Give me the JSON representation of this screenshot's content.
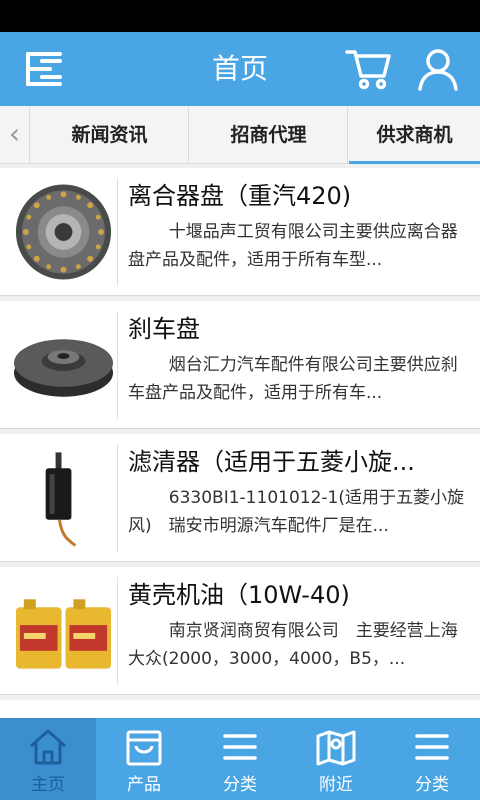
{
  "header": {
    "title": "首页",
    "menu_icon": "menu-icon",
    "cart_icon": "cart-icon",
    "user_icon": "user-icon"
  },
  "tabs": {
    "prev_arrow": "‹",
    "items": [
      {
        "label": "新闻资讯"
      },
      {
        "label": "招商代理"
      },
      {
        "label": "供求商机",
        "active": true
      }
    ]
  },
  "list": [
    {
      "title": "离合器盘（重汽420)",
      "desc": "十堰品声工贸有限公司主要供应离合器盘产品及配件，适用于所有车型...",
      "image": "clutch-disc"
    },
    {
      "title": "刹车盘",
      "desc": "烟台汇力汽车配件有限公司主要供应刹车盘产品及配件，适用于所有车...",
      "image": "brake-disc"
    },
    {
      "title": "滤清器（适用于五菱小旋...",
      "desc": "6330BI1-1101012-1(适用于五菱小旋风)　瑞安市明源汽车配件厂是在...",
      "image": "fuel-filter"
    },
    {
      "title": "黄壳机油（10W-40)",
      "desc": "南京贤润商贸有限公司　主要经营上海大众(2000，3000，4000，B5，...",
      "image": "engine-oil"
    }
  ],
  "bottom_nav": [
    {
      "label": "主页",
      "icon": "home-icon",
      "active": true
    },
    {
      "label": "产品",
      "icon": "bag-icon"
    },
    {
      "label": "分类",
      "icon": "list-icon"
    },
    {
      "label": "附近",
      "icon": "map-icon"
    },
    {
      "label": "分类",
      "icon": "list-icon"
    }
  ],
  "colors": {
    "primary": "#4aa5e5",
    "nav_active": "#3b8fcf",
    "status_bar": "#000000"
  }
}
